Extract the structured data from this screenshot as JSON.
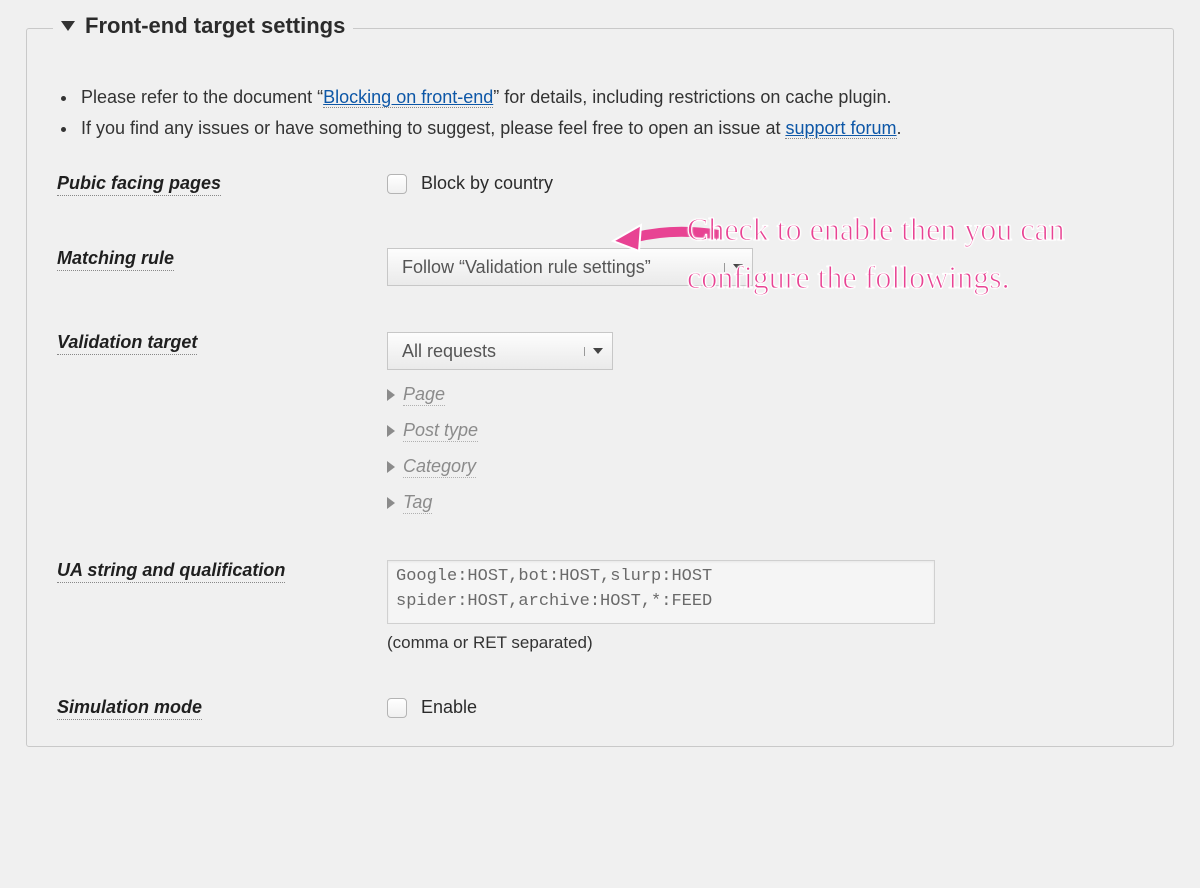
{
  "legend": "Front-end target settings",
  "notes": {
    "line1_a": "Please refer to the document “",
    "line1_link": "Blocking on front-end",
    "line1_b": "” for details, including restrictions on cache plugin.",
    "line2_a": "If you find any issues or have something to suggest, please feel free to open an issue at ",
    "line2_link": "support forum",
    "line2_b": "."
  },
  "rows": {
    "public_pages": {
      "label": "Pubic facing pages",
      "checkbox_label": "Block by country"
    },
    "matching_rule": {
      "label": "Matching rule",
      "value": "Follow “Validation rule settings”"
    },
    "validation_target": {
      "label": "Validation target",
      "value": "All requests",
      "subs": [
        "Page",
        "Post type",
        "Category",
        "Tag"
      ]
    },
    "ua": {
      "label": "UA string and qualification",
      "value": "Google:HOST,bot:HOST,slurp:HOST\nspider:HOST,archive:HOST,*:FEED",
      "hint": "(comma or RET separated)"
    },
    "simulation": {
      "label": "Simulation mode",
      "checkbox_label": "Enable"
    }
  },
  "annotation": "Check to enable then you can configure the followings."
}
